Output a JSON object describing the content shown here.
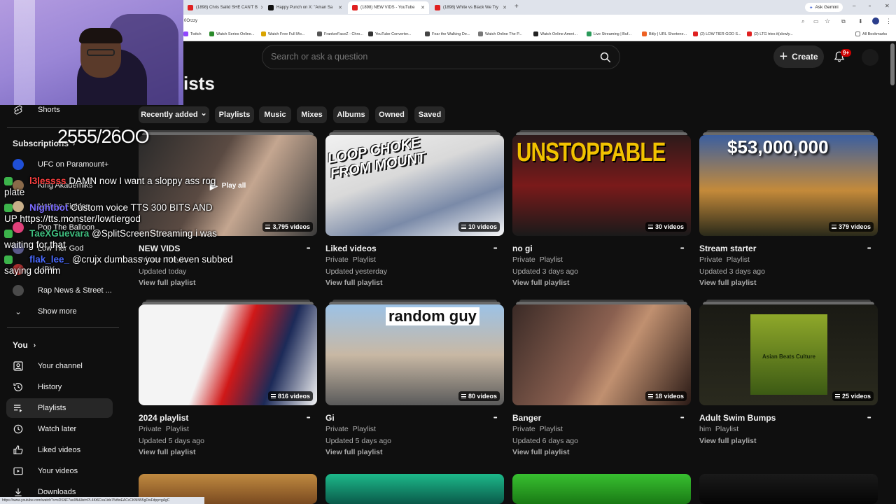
{
  "browser": {
    "tabs": [
      {
        "label": "(1898) Chris Sailid SHE CAN'T B",
        "color": "#e02020",
        "active": false
      },
      {
        "label": "Happy Punch on X: \"Aman Sa",
        "color": "#111111",
        "active": false
      },
      {
        "label": "(1898) NEW VIDS - YouTube",
        "color": "#e02020",
        "active": true
      },
      {
        "label": "(1898) White vs Black We Try",
        "color": "#e02020",
        "active": false
      }
    ],
    "new_tab": "+",
    "ask_gemini": "Ask Gemini",
    "url": "0Orzzy",
    "bookmarks": [
      {
        "label": "Twitch",
        "color": "#9146ff"
      },
      {
        "label": "Watch Series Online...",
        "color": "#2a8a2a"
      },
      {
        "label": "Watch Free Full Mo...",
        "color": "#d9a400"
      },
      {
        "label": "FrankerFaceZ - Chro...",
        "color": "#555555"
      },
      {
        "label": "YouTube Converter...",
        "color": "#333333"
      },
      {
        "label": "Fear the Walking De...",
        "color": "#444444"
      },
      {
        "label": "Watch Online The P...",
        "color": "#777777"
      },
      {
        "label": "Watch Online Ameri...",
        "color": "#222222"
      },
      {
        "label": "Live Streaming | Buf...",
        "color": "#2a9a5a"
      },
      {
        "label": "Bitly | URL Shortene...",
        "color": "#ee6123"
      },
      {
        "label": "(2) LOW TIER GOD S...",
        "color": "#e02020"
      },
      {
        "label": "(2) LTG tries it(slowly...",
        "color": "#e02020"
      }
    ],
    "all_bookmarks": "All Bookmarks",
    "status_url": "https://www.youtube.com/watch?v=sDSNF7au9fk&list=PL4Kt6Cva1ids75dfwEACvCKMN55gDwFdpp=gAgC"
  },
  "header": {
    "search_placeholder": "Search or ask a question",
    "create_label": "Create",
    "notification_count": "9+"
  },
  "page": {
    "title_partial": "ists"
  },
  "sidebar": {
    "shorts_label": "Shorts",
    "subscriptions_label": "Subscriptions",
    "subscriptions": [
      {
        "label": "UFC on Paramount+",
        "color": "#1f4fd6"
      },
      {
        "label": "King Akademiks",
        "color": "#8a6a4a"
      },
      {
        "label": "Nathan Fielder",
        "color": "#c9b08a"
      },
      {
        "label": "Pop The Balloon",
        "color": "#e0407a"
      },
      {
        "label": "Low Tier God",
        "color": "#5a5a8a"
      },
      {
        "label": "LIPY",
        "color": "#aa3030"
      },
      {
        "label": "Rap News & Street ...",
        "color": "#4a4a4a"
      }
    ],
    "show_more_label": "Show more",
    "you_label": "You",
    "you_items": [
      {
        "label": "Your channel",
        "icon": "account-box-icon",
        "active": false
      },
      {
        "label": "History",
        "icon": "history-icon",
        "active": false
      },
      {
        "label": "Playlists",
        "icon": "playlists-icon",
        "active": true
      },
      {
        "label": "Watch later",
        "icon": "watch-later-icon",
        "active": false
      },
      {
        "label": "Liked videos",
        "icon": "thumbs-up-icon",
        "active": false
      },
      {
        "label": "Your videos",
        "icon": "your-videos-icon",
        "active": false
      },
      {
        "label": "Downloads",
        "icon": "download-icon",
        "active": false
      }
    ]
  },
  "chips": [
    {
      "label": "Recently added",
      "dropdown": true
    },
    {
      "label": "Playlists"
    },
    {
      "label": "Music"
    },
    {
      "label": "Mixes"
    },
    {
      "label": "Albums"
    },
    {
      "label": "Owned"
    },
    {
      "label": "Saved"
    }
  ],
  "playlists": [
    {
      "title": "NEW VIDS",
      "meta1": "Private",
      "meta2": "Playlist",
      "updated": "Updated today",
      "link": "View full playlist",
      "count": "3,795 videos",
      "thumb": "new-vids",
      "overlay": "Play all"
    },
    {
      "title": "Liked videos",
      "meta1": "Private",
      "meta2": "Playlist",
      "updated": "Updated yesterday",
      "link": "View full playlist",
      "count": "10 videos",
      "thumb": "liked",
      "overlay_text": "LOOP CHOKE FROM MOUNT"
    },
    {
      "title": "no gi",
      "meta1": "Private",
      "meta2": "Playlist",
      "updated": "Updated 3 days ago",
      "link": "View full playlist",
      "count": "30 videos",
      "thumb": "nogi",
      "overlay_text": "UNSTOPPABLE"
    },
    {
      "title": "Stream starter",
      "meta1": "Private",
      "meta2": "Playlist",
      "updated": "Updated 3 days ago",
      "link": "View full playlist",
      "count": "379 videos",
      "thumb": "stream",
      "overlay_text": "$53,000,000"
    },
    {
      "title": "2024 playlist",
      "meta1": "Private",
      "meta2": "Playlist",
      "updated": "Updated 5 days ago",
      "link": "View full playlist",
      "count": "816 videos",
      "thumb": "y2024"
    },
    {
      "title": "Gi",
      "meta1": "Private",
      "meta2": "Playlist",
      "updated": "Updated 5 days ago",
      "link": "View full playlist",
      "count": "80 videos",
      "thumb": "gi",
      "overlay_text": "random guy"
    },
    {
      "title": "Banger",
      "meta1": "Private",
      "meta2": "Playlist",
      "updated": "Updated 6 days ago",
      "link": "View full playlist",
      "count": "18 videos",
      "thumb": "banger"
    },
    {
      "title": "Adult Swim Bumps",
      "meta1": "him",
      "meta2": "Playlist",
      "updated": "",
      "link": "View full playlist",
      "count": "25 videos",
      "thumb": "adultswim",
      "overlay_text": "Asian Beats Culture"
    }
  ],
  "stream_overlay": {
    "counter": "2555/26OO",
    "chat": [
      {
        "user": "l3lessss",
        "user_color": "#ff4040",
        "message": "DAMN now I want a sloppy ass rog",
        "continuation": "plate"
      },
      {
        "user": "Nightbot",
        "user_color": "#7b6cff",
        "message": "Custom voice TTS 300 BITS AND",
        "continuation": "UP https://tts.monster/lowtiergod"
      },
      {
        "user": "TaeXGuevara",
        "user_color": "#3fbf7f",
        "message": "@SplitScreenStreaming i was",
        "continuation": "waiting for that"
      },
      {
        "user": "flak_lee_",
        "user_color": "#4a6aff",
        "message": "@crujx dumbass you not even subbed",
        "continuation": "saying domm"
      }
    ]
  }
}
